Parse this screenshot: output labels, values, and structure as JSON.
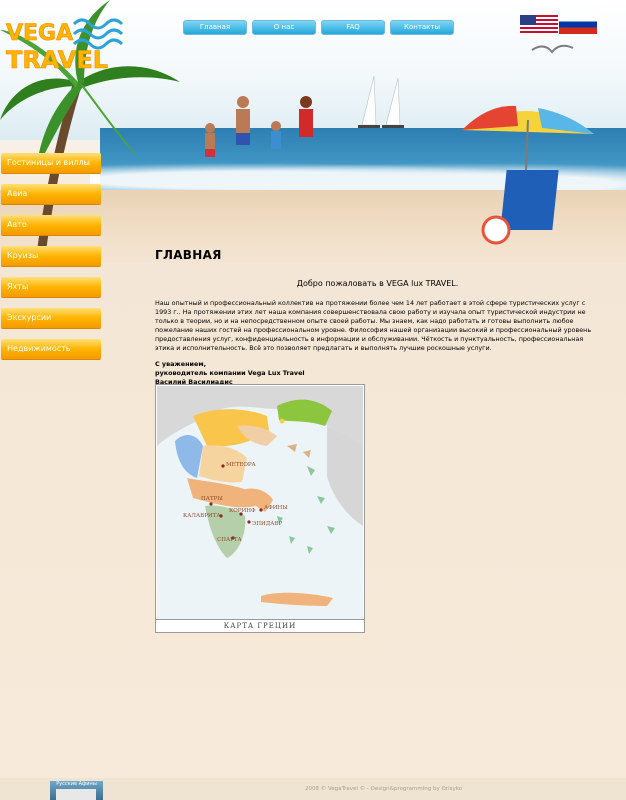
{
  "brand": {
    "logo_line1": "VEGA",
    "logo_line2": "TRAVEL"
  },
  "topnav": [
    {
      "label": "Главная"
    },
    {
      "label": "О нас"
    },
    {
      "label": "FAQ"
    },
    {
      "label": "Контакты"
    }
  ],
  "flags": [
    {
      "name": "us-flag-icon"
    },
    {
      "name": "ru-flag-icon"
    }
  ],
  "leftnav": [
    {
      "label": "Гостиницы и виллы"
    },
    {
      "label": "Авиа"
    },
    {
      "label": "Авто"
    },
    {
      "label": "Круизы"
    },
    {
      "label": "Яхты"
    },
    {
      "label": "Экскурсии"
    },
    {
      "label": "Недвижимость"
    }
  ],
  "main": {
    "title": "ГЛАВНАЯ",
    "welcome": "Добро пожаловать в VEGA lux TRAVEL.",
    "paragraph": "Наш опытный и профессиональный коллектив на протяжении более чем 14 лет работает в этой сфере туристических услуг с 1993 г.. На протяжении этих лет наша компания совершенствовала свою работу и изучала опыт туристической индустрии не только в теории, но и на непосредственном опыте своей работы. Мы знаем, как надо работать и готовы выполнить любое пожелание наших гостей на профессиональном уровне. Философия нашей организации высокий и профессиональный уровень предоставления услуг, конфиденциальность в информации и обслуживании. Чёткость и пунктуальность, профессиональная этика и исполнительность. Всё это позволяет предлагать и выполнять лучшие роскошные услуги.",
    "sign_1": "С уважением,",
    "sign_2": "руководитель компании Vega Lux Travel",
    "sign_3": "Василий Василиадис"
  },
  "map": {
    "caption": "КАРТА ГРЕЦИИ",
    "cities": [
      "МЕТЕОРА",
      "ПАТРЫ",
      "АФИНЫ",
      "КАЛАВРИТА",
      "КОРИНФ",
      "СПАРТА",
      "ЭПИДАВР"
    ]
  },
  "footer": {
    "banner_label": "Русские Афины",
    "copyright": "2008 © VegaTravel © - Design&programming by Orisyko"
  },
  "colors": {
    "topnav": "#23a7dc",
    "leftnav": "#ffb400",
    "sea": "#2d7fb1",
    "sand": "#f1dfc8"
  }
}
